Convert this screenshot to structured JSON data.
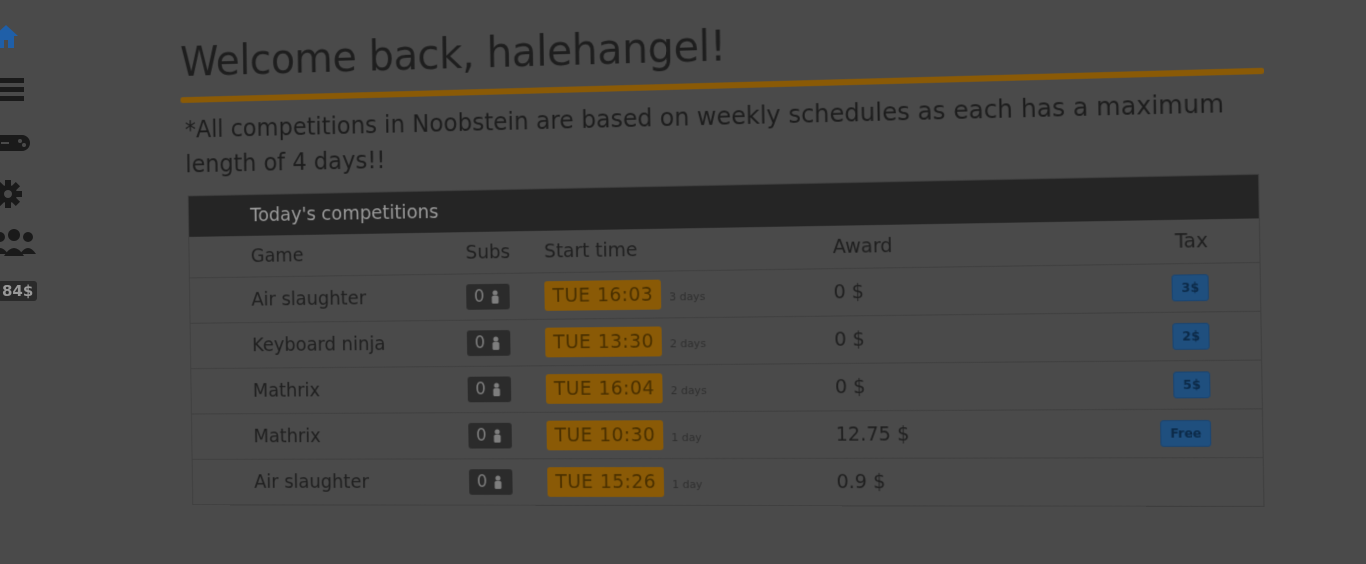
{
  "sidebar": {
    "items": [
      {
        "name": "home",
        "icon": "home-icon",
        "color": "#1f5fa8"
      },
      {
        "name": "list",
        "icon": "list-icon",
        "color": "#1a1a1a"
      },
      {
        "name": "games",
        "icon": "gamepad-icon",
        "color": "#1a1a1a"
      },
      {
        "name": "settings",
        "icon": "gear-icon",
        "color": "#1a1a1a"
      },
      {
        "name": "users",
        "icon": "users-icon",
        "color": "#1a1a1a"
      }
    ],
    "balance": "84$"
  },
  "header": {
    "welcome": "Welcome back, halehangel!"
  },
  "notice": "*All competitions in Noobstein are based on weekly schedules as each has a maximum length of 4 days!!",
  "competitions": {
    "title": "Today's competitions",
    "columns": {
      "game": "Game",
      "subs": "Subs",
      "start": "Start time",
      "award": "Award",
      "tax": "Tax"
    },
    "rows": [
      {
        "game": "Air slaughter",
        "subs": "0",
        "time": "TUE 16:03",
        "days": "3 days",
        "award": "0 $",
        "tax": "3$"
      },
      {
        "game": "Keyboard ninja",
        "subs": "0",
        "time": "TUE 13:30",
        "days": "2 days",
        "award": "0 $",
        "tax": "2$"
      },
      {
        "game": "Mathrix",
        "subs": "0",
        "time": "TUE 16:04",
        "days": "2 days",
        "award": "0 $",
        "tax": "5$"
      },
      {
        "game": "Mathrix",
        "subs": "0",
        "time": "TUE 10:30",
        "days": "1 day",
        "award": "12.75 $",
        "tax": "Free"
      },
      {
        "game": "Air slaughter",
        "subs": "0",
        "time": "TUE 15:26",
        "days": "1 day",
        "award": "0.9 $",
        "tax": ""
      }
    ]
  },
  "colors": {
    "backdrop": "#4a4a4a",
    "accent": "#8a5a06",
    "tax_button": "#1f4f7e",
    "panel_header": "#252525"
  }
}
